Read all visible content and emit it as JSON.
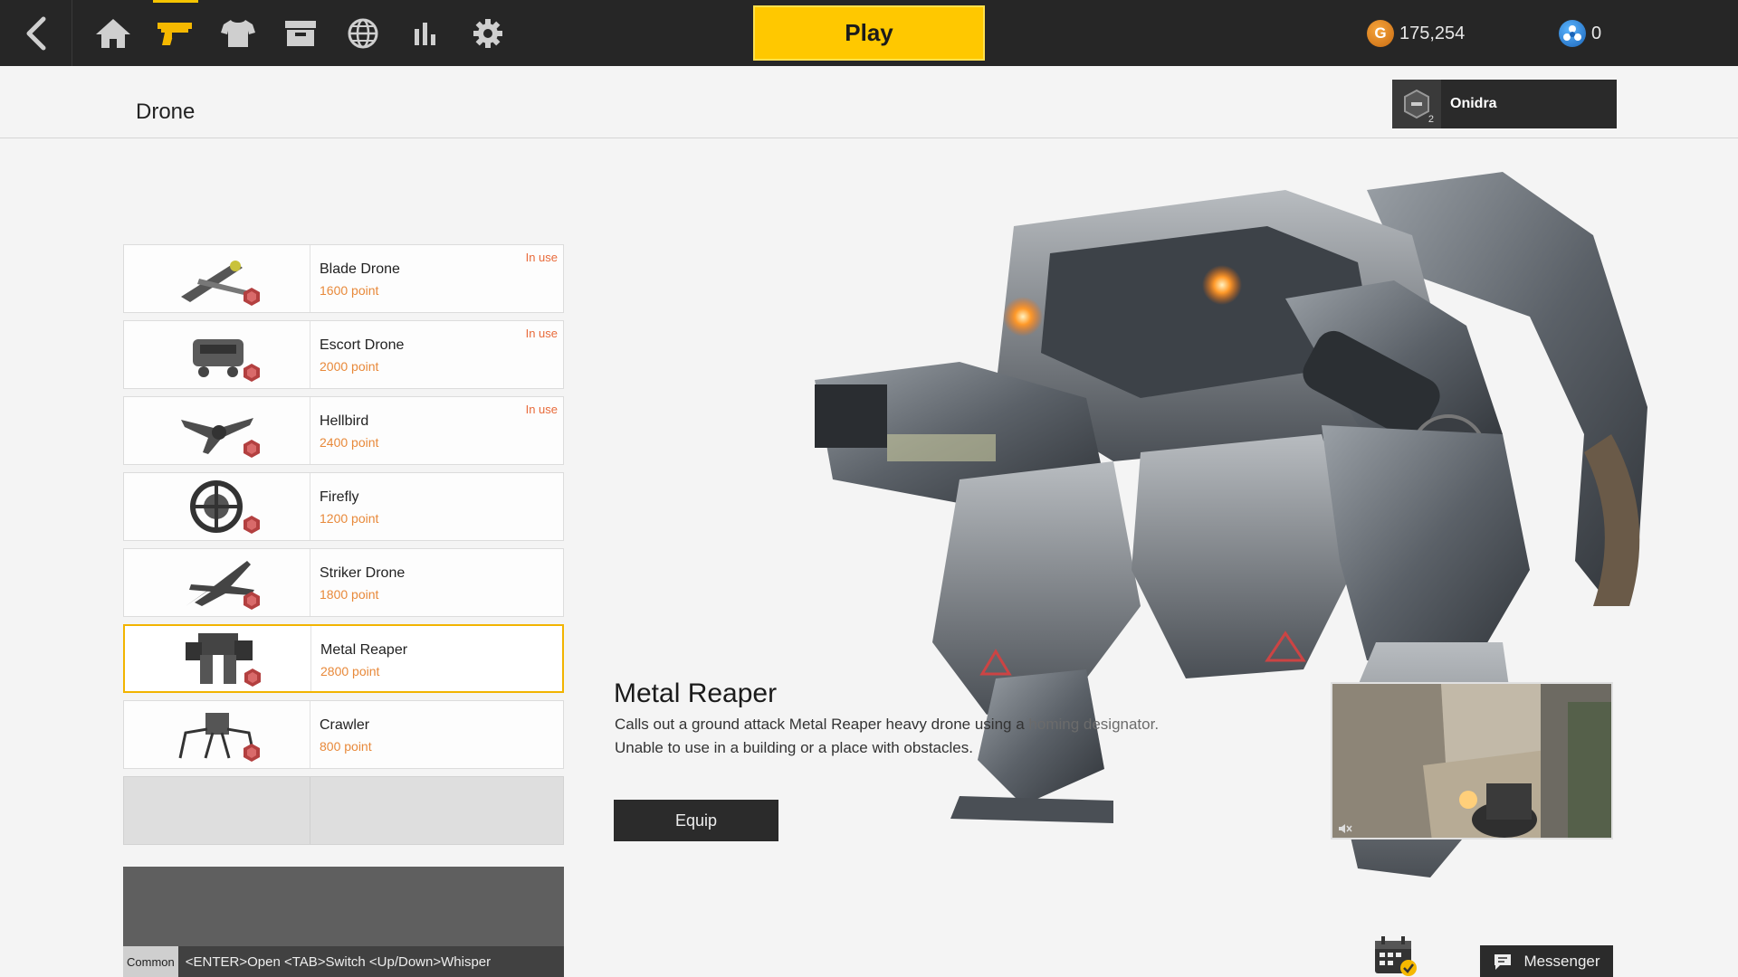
{
  "topbar": {
    "play_label": "Play",
    "gold_amount": "175,254",
    "gold_symbol": "G",
    "premium_amount": "0",
    "nav_icons": [
      "home-icon",
      "weapon-icon",
      "shirt-icon",
      "storage-box-icon",
      "globe-icon",
      "stats-icon",
      "gear-icon"
    ],
    "active_nav": "weapon-icon",
    "accent_color": "#ffc800"
  },
  "header": {
    "title": "Drone",
    "user": {
      "name": "Onidra",
      "level": "2"
    }
  },
  "drones": [
    {
      "name": "Blade Drone",
      "points": "1600 point",
      "status": "In use"
    },
    {
      "name": "Escort Drone",
      "points": "2000 point",
      "status": "In use"
    },
    {
      "name": "Hellbird",
      "points": "2400 point",
      "status": "In use"
    },
    {
      "name": "Firefly",
      "points": "1200 point",
      "status": ""
    },
    {
      "name": "Striker Drone",
      "points": "1800 point",
      "status": ""
    },
    {
      "name": "Metal Reaper",
      "points": "2800 point",
      "status": ""
    },
    {
      "name": "Crawler",
      "points": "800 point",
      "status": ""
    }
  ],
  "selected_drone": "Metal Reaper",
  "detail": {
    "title": "Metal Reaper",
    "description_line1": "Calls out a ground attack Metal Reaper heavy drone using a",
    "description_hidden": "homing designator.",
    "description_line2": "Unable to use in a building or a place with obstacles.",
    "equip_label": "Equip"
  },
  "chat": {
    "channel": "Common",
    "hint": "<ENTER>Open <TAB>Switch <Up/Down>Whisper"
  },
  "footer": {
    "messenger_label": "Messenger"
  }
}
